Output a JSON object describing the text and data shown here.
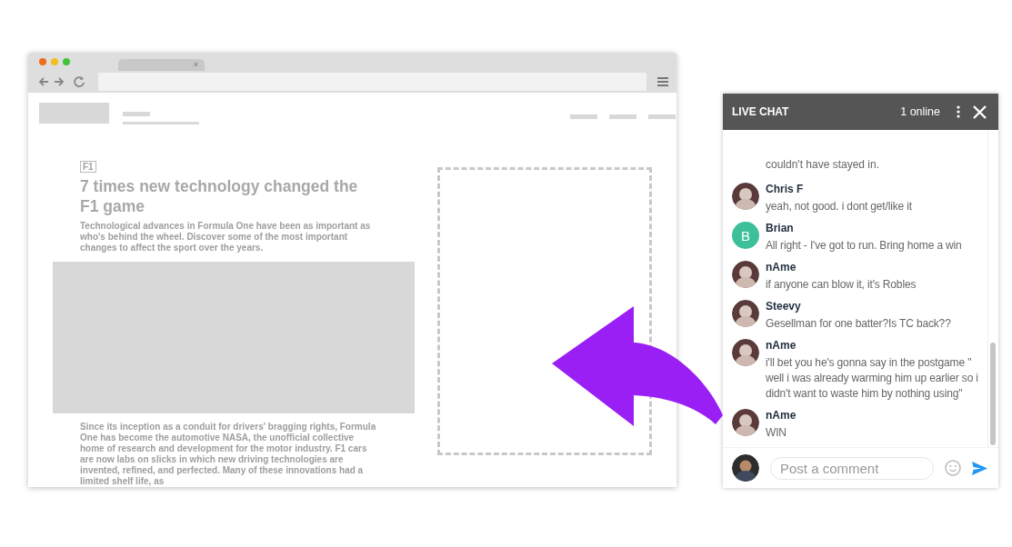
{
  "browser": {
    "tab": {
      "close": "×"
    },
    "article": {
      "tag": "F1",
      "headline": "7 times new technology changed the F1 game",
      "summary": "Technological advances in Formula One have been as important as who's behind the wheel. Discover some of the most important changes to affect the sport over the years.",
      "body": "Since its inception as a conduit for drivers' bragging rights, Formula One has become the automotive NASA, the unofficial collective home of research and development for the motor industry. F1 cars are now labs on slicks in which new driving technologies are invented, refined, and perfected. Many of these innovations had a limited shelf life, as"
    }
  },
  "chat": {
    "title": "LIVE CHAT",
    "online": "1 online",
    "messages": [
      {
        "kind": "cut",
        "text": "couldn't have stayed in."
      },
      {
        "kind": "photo",
        "name": "Chris F",
        "text": "yeah, not good. i dont get/like it"
      },
      {
        "kind": "letter",
        "initial": "B",
        "name": "Brian",
        "text": "All right - I've got to run. Bring home a win"
      },
      {
        "kind": "photo",
        "name": "nAme",
        "text": "if anyone can blow it, it's Robles"
      },
      {
        "kind": "photo",
        "name": "Steevy",
        "text": "Gesellman for one batter?Is TC back??"
      },
      {
        "kind": "photo",
        "name": "nAme",
        "text": "i'll bet you he's gonna say in the postgame \" well i was already warming him up earlier so i didn't want to waste him by nothing using\""
      },
      {
        "kind": "photo",
        "name": "nAme",
        "text": "WIN"
      }
    ],
    "composer": {
      "placeholder": "Post a comment"
    }
  }
}
